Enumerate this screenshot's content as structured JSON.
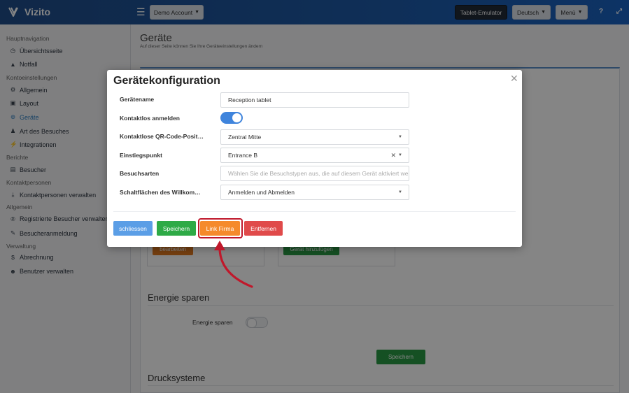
{
  "topbar": {
    "brand": "Vizito",
    "account_label": "Demo Account",
    "emulator_label": "Tablet-Emulator",
    "language_label": "Deutsch",
    "menu_label": "Menü",
    "help_icon": "question-icon",
    "expand_icon": "expand-icon",
    "hamburger_icon": "hamburger-icon"
  },
  "sidebar": {
    "sections": [
      {
        "title": "Hauptnavigation",
        "items": [
          {
            "label": "Übersichtsseite",
            "icon": "dashboard-icon"
          },
          {
            "label": "Notfall",
            "icon": "warning-icon"
          }
        ]
      },
      {
        "title": "Kontoeinstellungen",
        "items": [
          {
            "label": "Allgemein",
            "icon": "gear-icon"
          },
          {
            "label": "Layout",
            "icon": "image-icon"
          },
          {
            "label": "Geräte",
            "icon": "sitemap-icon",
            "active": true
          },
          {
            "label": "Art des Besuches",
            "icon": "users-icon"
          },
          {
            "label": "Integrationen",
            "icon": "plug-icon"
          }
        ]
      },
      {
        "title": "Berichte",
        "items": [
          {
            "label": "Besucher",
            "icon": "book-icon"
          }
        ]
      },
      {
        "title": "Kontaktpersonen",
        "items": [
          {
            "label": "Kontaktpersonen verwalten",
            "icon": "download-icon"
          }
        ]
      },
      {
        "title": "Allgemein",
        "items": [
          {
            "label": "Registrierte Besucher verwalten",
            "icon": "registered-icon"
          },
          {
            "label": "Besucheranmeldung",
            "icon": "pencil-icon"
          }
        ]
      },
      {
        "title": "Verwaltung",
        "items": [
          {
            "label": "Abrechnung",
            "icon": "dollar-icon"
          },
          {
            "label": "Benutzer verwalten",
            "icon": "user-plus-icon"
          }
        ]
      }
    ]
  },
  "main": {
    "title": "Geräte",
    "subtitle": "Auf dieser Seite können Sie Ihre Geräteeinstellungen ändern",
    "edit_button": "bearbeiten",
    "add_device_button": "Gerät hinzufügen",
    "energy_heading": "Energie sparen",
    "energy_label": "Energie sparen",
    "save_button": "Speichern",
    "print_heading": "Drucksysteme"
  },
  "modal": {
    "title": "Gerätekonfiguration",
    "fields": {
      "device_name": {
        "label": "Gerätename",
        "value": "Reception tablet"
      },
      "contactless": {
        "label": "Kontaktlos anmelden",
        "on": true
      },
      "qr_position": {
        "label": "Kontaktlose QR-Code-Position",
        "value": "Zentral Mitte"
      },
      "entry_point": {
        "label": "Einstiegspunkt",
        "value": "Entrance B"
      },
      "visit_types": {
        "label": "Besuchsarten",
        "placeholder": "Wählen Sie die Besuchstypen aus, die auf diesem Gerät aktiviert werden"
      },
      "welcome_buttons": {
        "label": "Schaltflächen des Willkommensbildschirms",
        "value": "Anmelden und Abmelden"
      }
    },
    "buttons": {
      "close": "schliessen",
      "save": "Speichern",
      "link": "Link Firma",
      "remove": "Entfernen"
    }
  },
  "colors": {
    "primary": "#5b9ee6",
    "success": "#2eaa46",
    "warning": "#f58a2b",
    "danger": "#e04a4a",
    "highlight": "#c0182b"
  }
}
